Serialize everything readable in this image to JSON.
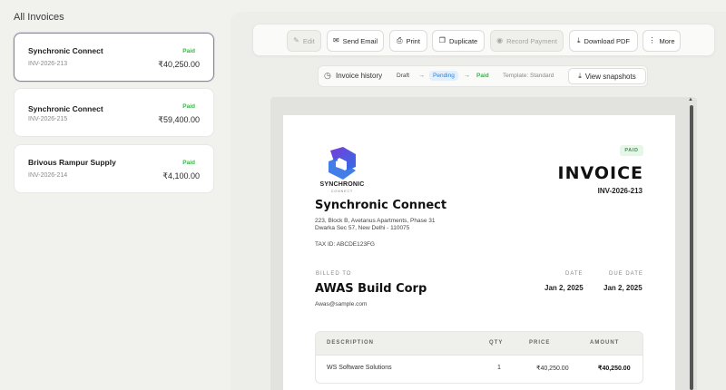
{
  "sidebar": {
    "title": "All Invoices",
    "invoices": [
      {
        "name": "Synchronic Connect",
        "number": "INV-2026-213",
        "status": "Paid",
        "amount": "₹40,250.00"
      },
      {
        "name": "Synchronic Connect",
        "number": "INV-2026-215",
        "status": "Paid",
        "amount": "₹59,400.00"
      },
      {
        "name": "Brivous Rampur Supply",
        "number": "INV-2026-214",
        "status": "Paid",
        "amount": "₹4,100.00"
      }
    ]
  },
  "toolbar": {
    "edit": "Edit",
    "send_email": "Send Email",
    "print": "Print",
    "duplicate": "Duplicate",
    "record_payment": "Record Payment",
    "download_pdf": "Download PDF",
    "more": "More"
  },
  "history": {
    "label": "Invoice history",
    "steps": [
      "Draft",
      "Pending",
      "Paid"
    ],
    "arrow": "→",
    "template": "Template: Standard",
    "snapshots": "View snapshots"
  },
  "invoice": {
    "logo_text": "SYNCHRONIC",
    "logo_sub": "CONNECT",
    "status_badge": "PAID",
    "title": "INVOICE",
    "number": "INV-2026-213",
    "company": "Synchronic Connect",
    "address_line1": "223, Block B, Avetanus Apartments, Phase 31",
    "address_line2": "Dwarka Sec 57, New Delhi - 110075",
    "tax_id": "TAX ID: ABCDE123FG",
    "billed_to_label": "BILLED TO",
    "billed_to_name": "AWAS Build Corp",
    "billed_to_email": "Awas@sample.com",
    "date_label": "DATE",
    "date": "Jan 2, 2025",
    "due_label": "DUE DATE",
    "due_date": "Jan 2, 2025",
    "table": {
      "headers": [
        "DESCRIPTION",
        "QTY",
        "PRICE",
        "AMOUNT"
      ],
      "rows": [
        {
          "description": "WS Software Solutions",
          "qty": "1",
          "price": "₹40,250.00",
          "amount": "₹40,250.00"
        }
      ]
    }
  },
  "colors": {
    "accent_paid": "#3bb34a",
    "accent_pending": "#2a7fd6",
    "logo_blue": "#3b6fe0",
    "logo_purple": "#a23bd6"
  }
}
